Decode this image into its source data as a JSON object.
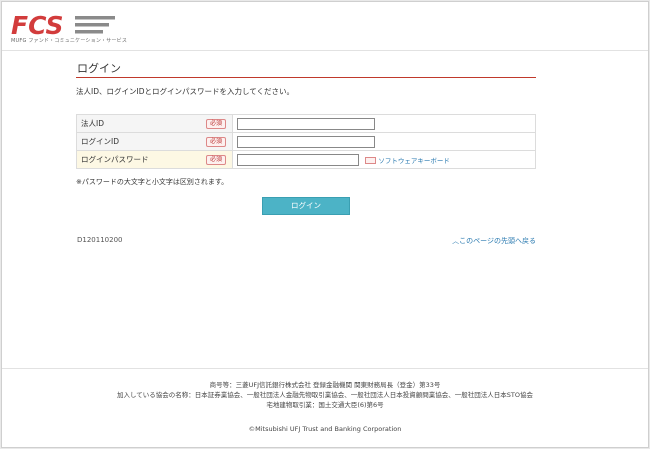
{
  "header": {
    "logo_text": "FCS",
    "logo_subtitle": "MUFG ファンド・コミュニケーション・サービス"
  },
  "main": {
    "title": "ログイン",
    "intro": "法人ID、ログインIDとログインパスワードを入力してください。",
    "required_badge": "必須",
    "fields": [
      {
        "label": "法人ID",
        "value": ""
      },
      {
        "label": "ログインID",
        "value": ""
      },
      {
        "label": "ログインパスワード",
        "value": ""
      }
    ],
    "software_keyboard_label": "ソフトウェアキーボード",
    "note": "※パスワードの大文字と小文字は区別されます。",
    "login_button": "ログイン",
    "screen_code": "D120110200",
    "to_top_link": "このページの先頭へ戻る"
  },
  "footer": {
    "line1": "商号等：三菱UFJ信託銀行株式会社 登録金融機関 関東財務局長（登金）第33号",
    "line2": "加入している協会の名称：日本証券業協会、一般社団法人金融先物取引業協会、一般社団法人日本投資顧問業協会、一般社団法人日本STO協会",
    "line3": "宅地建物取引業：国土交通大臣(6)第6号",
    "copyright": "©Mitsubishi UFJ Trust and Banking Corporation"
  },
  "colors": {
    "accent_red": "#c0392b",
    "button_teal": "#4cb3c6",
    "link_blue": "#2a7ab0",
    "logo_red": "#d23c3c",
    "logo_gray": "#8a8a8a"
  }
}
